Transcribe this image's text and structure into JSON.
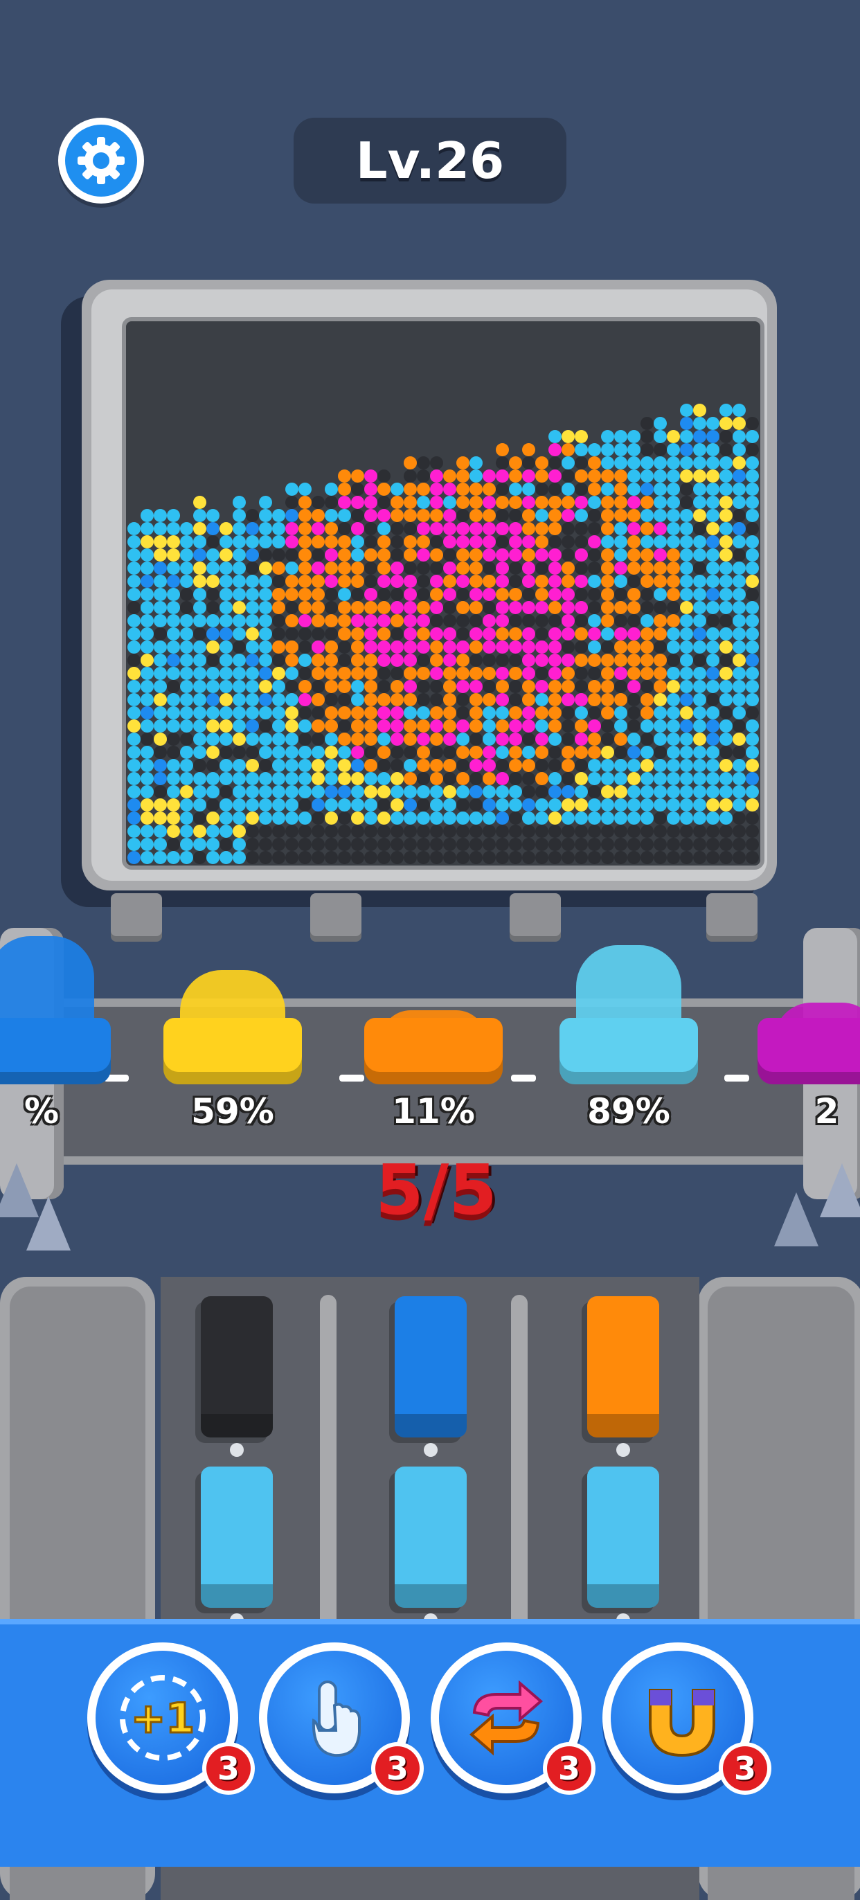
{
  "header": {
    "level_label": "Lv.26"
  },
  "board": {
    "colors": {
      "cyan": "#2fc0f2",
      "orange": "#ff8a0a",
      "magenta": "#ff1fd1",
      "yellow": "#ffe23b",
      "black": "#2c2e33",
      "blue": "#1e8bf0"
    }
  },
  "conveyor": {
    "carts": [
      {
        "label": "%",
        "color": "#1c7fe6",
        "fill": 1.0
      },
      {
        "label": "59%",
        "color": "#ffd21e",
        "fill": 0.59
      },
      {
        "label": "11%",
        "color": "#ff8a0a",
        "fill": 0.11
      },
      {
        "label": "89%",
        "color": "#5fd0f0",
        "fill": 0.89
      },
      {
        "label": "2",
        "color": "#c419c0",
        "fill": 0.2
      }
    ],
    "counter": "5/5"
  },
  "parking": {
    "rows": [
      [
        "#2b2c30",
        "#1c7fe6",
        "#ff8a0a"
      ],
      [
        "#4fc3f0",
        "#4fc3f0",
        "#4fc3f0"
      ],
      [
        "#ff2f92",
        "#ff8a0a",
        "#1c7fe6"
      ]
    ]
  },
  "powerups": [
    {
      "name": "plus-one",
      "icon": "plus-one-icon",
      "count": "3"
    },
    {
      "name": "tap",
      "icon": "pointing-hand-icon",
      "count": "3"
    },
    {
      "name": "shuffle",
      "icon": "shuffle-arrows-icon",
      "count": "3"
    },
    {
      "name": "magnet",
      "icon": "magnet-icon",
      "count": "3"
    }
  ]
}
